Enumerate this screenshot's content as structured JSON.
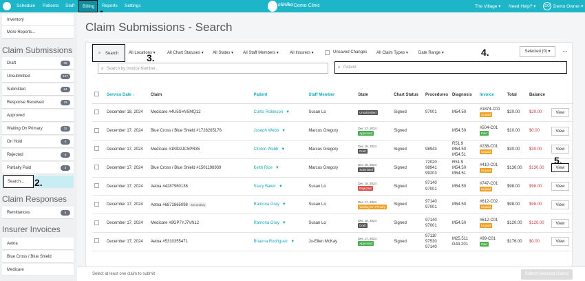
{
  "nav": {
    "items": [
      "Schedule",
      "Patients",
      "Staff"
    ],
    "billing": "Billing",
    "after": [
      "Reports",
      "Settings"
    ],
    "brand_word": "cliniko",
    "clinic": "Demo Clinic",
    "location": "The Village ▾",
    "help": "Need Help? ▾",
    "avatar": "DO",
    "user": "Demo Owner ▾"
  },
  "annotations": [
    "1.",
    "2.",
    "3.",
    "4.",
    "5."
  ],
  "sidebar": {
    "top_items": [
      "Inventory",
      "More Reports..."
    ],
    "claim_submissions_head": "Claim Submissions",
    "claims": [
      {
        "label": "Draft",
        "count": "35"
      },
      {
        "label": "Unsubmitted",
        "count": "127"
      },
      {
        "label": "Submitted",
        "count": "64"
      },
      {
        "label": "Response Received",
        "count": "33"
      },
      {
        "label": "Approved",
        "count": ""
      },
      {
        "label": "Waiting On Primary",
        "count": "25"
      },
      {
        "label": "On Hold",
        "count": "0"
      },
      {
        "label": "Rejected",
        "count": "8"
      },
      {
        "label": "Partially Paid",
        "count": "0"
      }
    ],
    "search_label": "Search...",
    "claim_responses_head": "Claim Responses",
    "remittances": {
      "label": "Remittances",
      "count": "6"
    },
    "insurer_invoices_head": "Insurer Invoices",
    "insurers": [
      "Aetna",
      "Blue Cross / Blue Shield",
      "Medicare"
    ]
  },
  "main": {
    "title": "Claim Submissions - Search",
    "search_btn": "Search",
    "filters": [
      "All Locations ▾",
      "All Chart Statuses ▾",
      "All States ▾",
      "All Staff Members ▾",
      "All Insurers ▾",
      "Unsaved Changes",
      "All Claim Types ▾",
      "Date Range ▾"
    ],
    "selected": "Selected (0) ▾",
    "more": "···",
    "invoice_placeholder": "Search by Invoice Number...",
    "patient_placeholder": "Patient",
    "columns": [
      "Service Date ↓",
      "Claim",
      "Patient",
      "Staff Member",
      "State",
      "Chart Status",
      "Procedures",
      "Diagnosis",
      "Invoice",
      "Total",
      "Balance",
      ""
    ],
    "rows": [
      {
        "date": "December 18, 2024",
        "claim": "Medicare #4U5SHV5MQ12",
        "secondary": "",
        "patient": "Curtis Robinson",
        "staff": "Susan Lo",
        "state_date": "",
        "state": "Unsubmitted",
        "state_cls": "unsub",
        "chart": "Signed",
        "proc": "97001",
        "diag": "M54.50",
        "inv": "#1874-C01",
        "inv_status": "Unpaid",
        "inv_cls": "unpaid",
        "total": "$20.00",
        "balance": "$20.00",
        "view": "View"
      },
      {
        "date": "December 17, 2024",
        "claim": "Blue Cross / Blue Shield #1728265176",
        "secondary": "",
        "patient": "Joseph Webb",
        "staff": "Marcus Gregory",
        "state_date": "Dec 17, 2024",
        "state": "Approved",
        "state_cls": "approved",
        "chart": "Signed",
        "proc": "",
        "diag": "M54.50",
        "inv": "#504-C01",
        "inv_status": "Paid",
        "inv_cls": "paid",
        "total": "$10.00",
        "balance": "$0.00",
        "view": "View"
      },
      {
        "date": "December 17, 2024",
        "claim": "Medicare #1MD2JC5PR35",
        "secondary": "",
        "patient": "Clinton Webb",
        "staff": "Marcus Gregory",
        "state_date": "Dec 18, 2024",
        "state": "Draft",
        "state_cls": "draft",
        "chart": "Signed",
        "proc": "98943",
        "diag": "R51.9\nM54.50\nM54.51",
        "inv": "#238-C01",
        "inv_status": "Unpaid",
        "inv_cls": "unpaid",
        "total": "$30.00",
        "balance": "$30.00",
        "view": "View"
      },
      {
        "date": "December 17, 2024",
        "claim": "Blue Cross / Blue Shield #1501198939",
        "secondary": "",
        "patient": "Keith Rice",
        "staff": "Marcus Gregory",
        "state_date": "Dec 18, 2024",
        "state": "Submitted",
        "state_cls": "submitted",
        "chart": "Signed",
        "proc": "72020\n98941\n99203",
        "diag": "R51.9\nM54.50\nM54.51",
        "inv": "#410-C01",
        "inv_status": "Unpaid",
        "inv_cls": "unpaid",
        "total": "$130.00",
        "balance": "$130.00",
        "view": "View"
      },
      {
        "date": "December 17, 2024",
        "claim": "Aetna #4287960138",
        "secondary": "",
        "patient": "Stacy Baker",
        "staff": "Susan Lo",
        "state_date": "Dec 18, 2024",
        "state": "Rejected",
        "state_cls": "rejected",
        "chart": "Signed",
        "proc": "97140\n97001",
        "diag": "M54.50",
        "inv": "#747-C01",
        "inv_status": "Unpaid",
        "inv_cls": "unpaid",
        "total": "$98.00",
        "balance": "$98.00",
        "view": "View"
      },
      {
        "date": "December 17, 2024",
        "claim": "Aetna #6872865098",
        "secondary": "Secondary",
        "patient": "Ramona Gray",
        "staff": "Susan Lo",
        "state_date": "Dec 17, 2024",
        "state": "Waiting On Primary",
        "state_cls": "waiting",
        "chart": "Signed",
        "proc": "97140\n97001",
        "diag": "M54.50",
        "inv": "#612-C02",
        "inv_status": "Unpaid",
        "inv_cls": "unpaid",
        "total": "$98.00",
        "balance": "$98.00",
        "view": "View"
      },
      {
        "date": "December 17, 2024",
        "claim": "Medicare #9GP7YJ7VN12",
        "secondary": "",
        "patient": "Ramona Gray",
        "staff": "Susan Lo",
        "state_date": "Dec 18, 2024",
        "state": "Draft",
        "state_cls": "draft",
        "chart": "Signed",
        "proc": "97140\n97001",
        "diag": "M54.50",
        "inv": "#612-C01",
        "inv_status": "Unpaid",
        "inv_cls": "unpaid",
        "total": "$120.00",
        "balance": "$120.00",
        "view": "View"
      },
      {
        "date": "December 17, 2024",
        "claim": "Aetna #5310355471",
        "secondary": "",
        "patient": "Brianna Rodriguez",
        "staff": "Jo-Ellen McKay",
        "state_date": "Dec 17, 2024",
        "state": "Approved",
        "state_cls": "approved",
        "chart": "Signed",
        "proc": "97110\n97530\n97140",
        "diag": "M25.511\nG44.201",
        "inv": "#99-C01",
        "inv_status": "Paid",
        "inv_cls": "paid",
        "total": "$176.00",
        "balance": "$0.00",
        "view": "View"
      }
    ],
    "footer_text": "Select at least one claim to submit",
    "submit_btn": "Submit Selected Claims"
  }
}
